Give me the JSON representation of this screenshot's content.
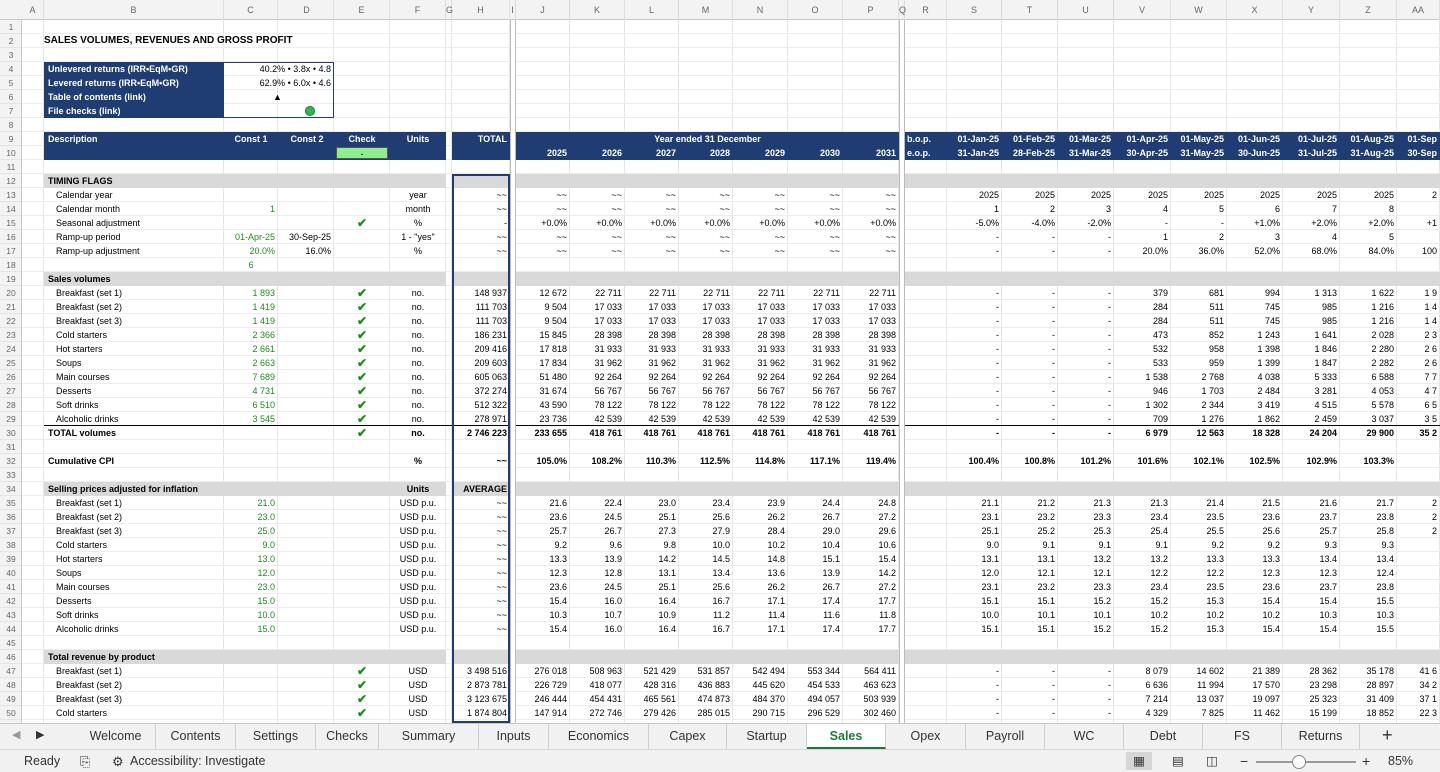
{
  "columns": [
    "A",
    "B",
    "C",
    "D",
    "E",
    "F",
    "G",
    "H",
    "I",
    "J",
    "K",
    "L",
    "M",
    "N",
    "O",
    "P",
    "Q",
    "R",
    "S",
    "T",
    "U",
    "V",
    "W",
    "X",
    "Y",
    "Z",
    "AA"
  ],
  "rows": [
    "1",
    "2",
    "3",
    "4",
    "5",
    "6",
    "7",
    "8",
    "9",
    "10",
    "11",
    "12",
    "13",
    "14",
    "15",
    "16",
    "17",
    "18",
    "19",
    "20",
    "21",
    "22",
    "23",
    "24",
    "25",
    "26",
    "27",
    "28",
    "29",
    "30",
    "31",
    "32",
    "33",
    "34",
    "35",
    "36",
    "37",
    "38",
    "39",
    "40",
    "41",
    "42",
    "43",
    "44",
    "45",
    "46",
    "47",
    "48",
    "49",
    "50"
  ],
  "title": "SALES VOLUMES, REVENUES AND GROSS PROFIT",
  "summary_box": [
    {
      "label": "Unlevered returns (IRR•EqM•GR)",
      "value": "40.2% • 3.8x • 4.8"
    },
    {
      "label": "Levered returns (IRR•EqM•GR)",
      "value": "62.9% • 6.0x • 4.6"
    },
    {
      "label": "Table of contents (link)",
      "value": "▲"
    },
    {
      "label": "File checks (link)",
      "value": ""
    }
  ],
  "header": {
    "description": "Description",
    "const1": "Const 1",
    "const2": "Const 2",
    "check": "Check",
    "units": "Units",
    "total": "TOTAL",
    "year_ended": "Year ended 31 December",
    "check_value": "-",
    "years": [
      "2025",
      "2026",
      "2027",
      "2028",
      "2029",
      "2030",
      "2031"
    ],
    "bop": "b.o.p.",
    "eop": "e.o.p.",
    "month_start": [
      "01-Jan-25",
      "01-Feb-25",
      "01-Mar-25",
      "01-Apr-25",
      "01-May-25",
      "01-Jun-25",
      "01-Jul-25",
      "01-Aug-25",
      "01-Sep"
    ],
    "month_end": [
      "31-Jan-25",
      "28-Feb-25",
      "31-Mar-25",
      "30-Apr-25",
      "31-May-25",
      "30-Jun-25",
      "31-Jul-25",
      "31-Aug-25",
      "30-Sep"
    ]
  },
  "timing": {
    "section": "TIMING FLAGS",
    "rows": [
      {
        "label": "Calendar year",
        "c1": "",
        "c2": "",
        "units": "year",
        "total": "~~",
        "years": [
          "~~",
          "~~",
          "~~",
          "~~",
          "~~",
          "~~",
          "~~"
        ],
        "months": [
          "2025",
          "2025",
          "2025",
          "2025",
          "2025",
          "2025",
          "2025",
          "2025",
          "2"
        ]
      },
      {
        "label": "Calendar month",
        "c1": "1",
        "c2": "",
        "units": "month",
        "total": "~~",
        "years": [
          "~~",
          "~~",
          "~~",
          "~~",
          "~~",
          "~~",
          "~~"
        ],
        "months": [
          "1",
          "2",
          "3",
          "4",
          "5",
          "6",
          "7",
          "8",
          ""
        ]
      },
      {
        "label": "Seasonal adjustment",
        "c1": "",
        "c2": "",
        "check": true,
        "units": "%",
        "total": "-",
        "years": [
          "+0.0%",
          "+0.0%",
          "+0.0%",
          "+0.0%",
          "+0.0%",
          "+0.0%",
          "+0.0%"
        ],
        "months": [
          "-5.0%",
          "-4.0%",
          "-2.0%",
          "-",
          "-",
          "+1.0%",
          "+2.0%",
          "+2.0%",
          "+1"
        ]
      },
      {
        "label": "Ramp-up period",
        "c1": "01-Apr-25",
        "c2": "30-Sep-25",
        "units": "1 - \"yes\"",
        "total": "~~",
        "years": [
          "~~",
          "~~",
          "~~",
          "~~",
          "~~",
          "~~",
          "~~"
        ],
        "months": [
          "-",
          "-",
          "-",
          "1",
          "2",
          "3",
          "4",
          "5",
          ""
        ]
      },
      {
        "label": "Ramp-up adjustment",
        "c1": "20.0%",
        "c2": "16.0%",
        "units": "%",
        "total": "~~",
        "years": [
          "~~",
          "~~",
          "~~",
          "~~",
          "~~",
          "~~",
          "~~"
        ],
        "months": [
          "-",
          "-",
          "-",
          "20.0%",
          "36.0%",
          "52.0%",
          "68.0%",
          "84.0%",
          "100"
        ]
      }
    ],
    "row18_c1": "6"
  },
  "volumes": {
    "section": "Sales volumes",
    "rows": [
      {
        "label": "Breakfast (set 1)",
        "c1": "1 893",
        "units": "no.",
        "total": "148 937",
        "years": [
          "12 672",
          "22 711",
          "22 711",
          "22 711",
          "22 711",
          "22 711",
          "22 711"
        ],
        "months": [
          "-",
          "-",
          "-",
          "379",
          "681",
          "994",
          "1 313",
          "1 622",
          "1 9"
        ]
      },
      {
        "label": "Breakfast (set 2)",
        "c1": "1 419",
        "units": "no.",
        "total": "111 703",
        "years": [
          "9 504",
          "17 033",
          "17 033",
          "17 033",
          "17 033",
          "17 033",
          "17 033"
        ],
        "months": [
          "-",
          "-",
          "-",
          "284",
          "511",
          "745",
          "985",
          "1 216",
          "1 4"
        ]
      },
      {
        "label": "Breakfast (set 3)",
        "c1": "1 419",
        "units": "no.",
        "total": "111 703",
        "years": [
          "9 504",
          "17 033",
          "17 033",
          "17 033",
          "17 033",
          "17 033",
          "17 033"
        ],
        "months": [
          "-",
          "-",
          "-",
          "284",
          "511",
          "745",
          "985",
          "1 216",
          "1 4"
        ]
      },
      {
        "label": "Cold starters",
        "c1": "2 366",
        "units": "no.",
        "total": "186 231",
        "years": [
          "15 845",
          "28 398",
          "28 398",
          "28 398",
          "28 398",
          "28 398",
          "28 398"
        ],
        "months": [
          "-",
          "-",
          "-",
          "473",
          "852",
          "1 243",
          "1 641",
          "2 028",
          "2 3"
        ]
      },
      {
        "label": "Hot starters",
        "c1": "2 661",
        "units": "no.",
        "total": "209 416",
        "years": [
          "17 818",
          "31 933",
          "31 933",
          "31 933",
          "31 933",
          "31 933",
          "31 933"
        ],
        "months": [
          "-",
          "-",
          "-",
          "532",
          "958",
          "1 398",
          "1 846",
          "2 280",
          "2 6"
        ]
      },
      {
        "label": "Soups",
        "c1": "2 663",
        "units": "no.",
        "total": "209 603",
        "years": [
          "17 834",
          "31 962",
          "31 962",
          "31 962",
          "31 962",
          "31 962",
          "31 962"
        ],
        "months": [
          "-",
          "-",
          "-",
          "533",
          "959",
          "1 399",
          "1 847",
          "2 282",
          "2 6"
        ]
      },
      {
        "label": "Main courses",
        "c1": "7 689",
        "units": "no.",
        "total": "605 063",
        "years": [
          "51 480",
          "92 264",
          "92 264",
          "92 264",
          "92 264",
          "92 264",
          "92 264"
        ],
        "months": [
          "-",
          "-",
          "-",
          "1 538",
          "2 768",
          "4 038",
          "5 333",
          "6 588",
          "7 7"
        ]
      },
      {
        "label": "Desserts",
        "c1": "4 731",
        "units": "no.",
        "total": "372 274",
        "years": [
          "31 674",
          "56 767",
          "56 767",
          "56 767",
          "56 767",
          "56 767",
          "56 767"
        ],
        "months": [
          "-",
          "-",
          "-",
          "946",
          "1 703",
          "2 484",
          "3 281",
          "4 053",
          "4 7"
        ]
      },
      {
        "label": "Soft drinks",
        "c1": "6 510",
        "units": "no.",
        "total": "512 322",
        "years": [
          "43 590",
          "78 122",
          "78 122",
          "78 122",
          "78 122",
          "78 122",
          "78 122"
        ],
        "months": [
          "-",
          "-",
          "-",
          "1 302",
          "2 344",
          "3 419",
          "4 515",
          "5 578",
          "6 5"
        ]
      },
      {
        "label": "Alcoholic drinks",
        "c1": "3 545",
        "units": "no.",
        "total": "278 971",
        "years": [
          "23 736",
          "42 539",
          "42 539",
          "42 539",
          "42 539",
          "42 539",
          "42 539"
        ],
        "months": [
          "-",
          "-",
          "-",
          "709",
          "1 276",
          "1 862",
          "2 459",
          "3 037",
          "3 5"
        ]
      }
    ],
    "total_row": {
      "label": "TOTAL volumes",
      "units": "no.",
      "total": "2 746 223",
      "years": [
        "233 655",
        "418 761",
        "418 761",
        "418 761",
        "418 761",
        "418 761",
        "418 761"
      ],
      "months": [
        "-",
        "-",
        "-",
        "6 979",
        "12 563",
        "18 328",
        "24 204",
        "29 900",
        "35 2"
      ]
    }
  },
  "cpi": {
    "label": "Cumulative CPI",
    "units": "%",
    "total": "~~",
    "years": [
      "105.0%",
      "108.2%",
      "110.3%",
      "112.5%",
      "114.8%",
      "117.1%",
      "119.4%"
    ],
    "months": [
      "100.4%",
      "100.8%",
      "101.2%",
      "101.6%",
      "102.1%",
      "102.5%",
      "102.9%",
      "103.3%",
      ""
    ]
  },
  "prices": {
    "section": "Selling prices adjusted for inflation",
    "units_hdr": "Units",
    "avg_hdr": "AVERAGE",
    "rows": [
      {
        "label": "Breakfast (set 1)",
        "c1": "21.0",
        "units": "USD p.u.",
        "total": "~~",
        "years": [
          "21.6",
          "22.4",
          "23.0",
          "23.4",
          "23.9",
          "24.4",
          "24.8"
        ],
        "months": [
          "21.1",
          "21.2",
          "21.3",
          "21.3",
          "21.4",
          "21.5",
          "21.6",
          "21.7",
          "2"
        ]
      },
      {
        "label": "Breakfast (set 2)",
        "c1": "23.0",
        "units": "USD p.u.",
        "total": "~~",
        "years": [
          "23.6",
          "24.5",
          "25.1",
          "25.6",
          "26.2",
          "26.7",
          "27.2"
        ],
        "months": [
          "23.1",
          "23.2",
          "23.3",
          "23.4",
          "23.5",
          "23.6",
          "23.7",
          "23.8",
          "2"
        ]
      },
      {
        "label": "Breakfast (set 3)",
        "c1": "25.0",
        "units": "USD p.u.",
        "total": "~~",
        "years": [
          "25.7",
          "26.7",
          "27.3",
          "27.9",
          "28.4",
          "29.0",
          "29.6"
        ],
        "months": [
          "25.1",
          "25.2",
          "25.3",
          "25.4",
          "25.5",
          "25.6",
          "25.7",
          "25.8",
          "2"
        ]
      },
      {
        "label": "Cold starters",
        "c1": "9.0",
        "units": "USD p.u.",
        "total": "~~",
        "years": [
          "9.2",
          "9.6",
          "9.8",
          "10.0",
          "10.2",
          "10.4",
          "10.6"
        ],
        "months": [
          "9.0",
          "9.1",
          "9.1",
          "9.1",
          "9.2",
          "9.2",
          "9.3",
          "9.3",
          ""
        ]
      },
      {
        "label": "Hot starters",
        "c1": "13.0",
        "units": "USD p.u.",
        "total": "~~",
        "years": [
          "13.3",
          "13.9",
          "14.2",
          "14.5",
          "14.8",
          "15.1",
          "15.4"
        ],
        "months": [
          "13.1",
          "13.1",
          "13.2",
          "13.2",
          "13.3",
          "13.3",
          "13.4",
          "13.4",
          ""
        ]
      },
      {
        "label": "Soups",
        "c1": "12.0",
        "units": "USD p.u.",
        "total": "~~",
        "years": [
          "12.3",
          "12.8",
          "13.1",
          "13.4",
          "13.6",
          "13.9",
          "14.2"
        ],
        "months": [
          "12.0",
          "12.1",
          "12.1",
          "12.2",
          "12.2",
          "12.3",
          "12.3",
          "12.4",
          ""
        ]
      },
      {
        "label": "Main courses",
        "c1": "23.0",
        "units": "USD p.u.",
        "total": "~~",
        "years": [
          "23.6",
          "24.5",
          "25.1",
          "25.6",
          "26.2",
          "26.7",
          "27.2"
        ],
        "months": [
          "23.1",
          "23.2",
          "23.3",
          "23.4",
          "23.5",
          "23.6",
          "23.7",
          "23.8",
          ""
        ]
      },
      {
        "label": "Desserts",
        "c1": "15.0",
        "units": "USD p.u.",
        "total": "~~",
        "years": [
          "15.4",
          "16.0",
          "16.4",
          "16.7",
          "17.1",
          "17.4",
          "17.7"
        ],
        "months": [
          "15.1",
          "15.1",
          "15.2",
          "15.2",
          "15.3",
          "15.4",
          "15.4",
          "15.5",
          ""
        ]
      },
      {
        "label": "Soft drinks",
        "c1": "10.0",
        "units": "USD p.u.",
        "total": "~~",
        "years": [
          "10.3",
          "10.7",
          "10.9",
          "11.2",
          "11.4",
          "11.6",
          "11.8"
        ],
        "months": [
          "10.0",
          "10.1",
          "10.1",
          "10.2",
          "10.2",
          "10.2",
          "10.3",
          "10.3",
          ""
        ]
      },
      {
        "label": "Alcoholic drinks",
        "c1": "15.0",
        "units": "USD p.u.",
        "total": "~~",
        "years": [
          "15.4",
          "16.0",
          "16.4",
          "16.7",
          "17.1",
          "17.4",
          "17.7"
        ],
        "months": [
          "15.1",
          "15.1",
          "15.2",
          "15.2",
          "15.3",
          "15.4",
          "15.4",
          "15.5",
          ""
        ]
      }
    ]
  },
  "revenue": {
    "section": "Total revenue by product",
    "rows": [
      {
        "label": "Breakfast (set 1)",
        "units": "USD",
        "total": "3 498 516",
        "years": [
          "276 018",
          "508 963",
          "521 429",
          "531 857",
          "542 494",
          "553 344",
          "564 411"
        ],
        "months": [
          "-",
          "-",
          "-",
          "8 079",
          "14 602",
          "21 389",
          "28 362",
          "35 178",
          "41 6"
        ]
      },
      {
        "label": "Breakfast (set 2)",
        "units": "USD",
        "total": "2 873 781",
        "years": [
          "226 729",
          "418 077",
          "428 316",
          "436 883",
          "445 620",
          "454 533",
          "463 623"
        ],
        "months": [
          "-",
          "-",
          "-",
          "6 636",
          "11 994",
          "17 570",
          "23 298",
          "28 897",
          "34 2"
        ]
      },
      {
        "label": "Breakfast (set 3)",
        "units": "USD",
        "total": "3 123 675",
        "years": [
          "246 444",
          "454 431",
          "465 561",
          "474 873",
          "484 370",
          "494 057",
          "503 939"
        ],
        "months": [
          "-",
          "-",
          "-",
          "7 214",
          "13 037",
          "19 097",
          "25 323",
          "31 409",
          "37 1"
        ]
      },
      {
        "label": "Cold starters",
        "units": "USD",
        "total": "1 874 804",
        "years": [
          "147 914",
          "272 746",
          "279 426",
          "285 015",
          "290 715",
          "296 529",
          "302 460"
        ],
        "months": [
          "-",
          "-",
          "-",
          "4 329",
          "7 825",
          "11 462",
          "15 199",
          "18 852",
          "22 3"
        ]
      }
    ]
  },
  "tabs": [
    "Welcome",
    "Contents",
    "Settings",
    "Checks",
    "Summary",
    "Inputs",
    "Economics",
    "Capex",
    "Startup",
    "Sales",
    "Opex",
    "Payroll",
    "WC",
    "Debt",
    "FS",
    "Returns"
  ],
  "active_tab": "Sales",
  "status": {
    "ready": "Ready",
    "accessibility": "Accessibility: Investigate",
    "zoom": "85%"
  },
  "colors": {
    "navy": "#1f3d73",
    "green": "#1e8c1e",
    "active_tab": "#1e7a3c",
    "check_green": "#90ee90"
  }
}
